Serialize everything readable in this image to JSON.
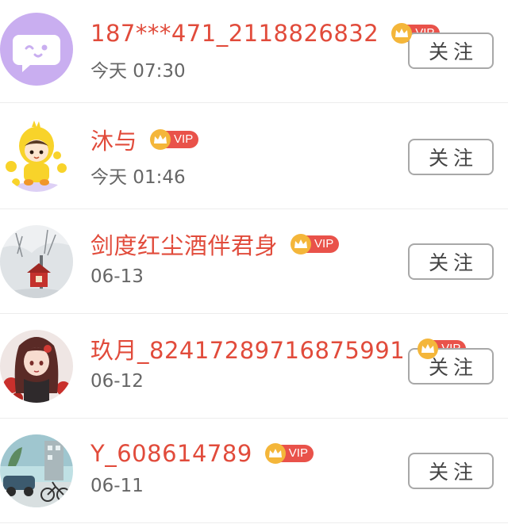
{
  "follow_list": [
    {
      "name": "187***471_2118826832",
      "vip_label": "VIP",
      "time": "今天 07:30",
      "button": "关注",
      "avatar": "chat-bubble-icon"
    },
    {
      "name": "沐与",
      "vip_label": "VIP",
      "time": "今天 01:46",
      "button": "关注",
      "avatar": "cartoon-chick-avatar"
    },
    {
      "name": "剑度红尘酒伴君身",
      "vip_label": "VIP",
      "time": "06-13",
      "button": "关注",
      "avatar": "winter-scene-avatar"
    },
    {
      "name": "玖月_82417289716875991",
      "vip_label": "VIP",
      "time": "06-12",
      "button": "关注",
      "avatar": "anime-girl-avatar"
    },
    {
      "name": "Y_608614789",
      "vip_label": "VIP",
      "time": "06-11",
      "button": "关注",
      "avatar": "street-scene-avatar"
    }
  ],
  "colors": {
    "name": "#e14b3b",
    "vip_tag": "#e9524a",
    "crown": "#f4b63a",
    "default_avatar_bg": "#c9aef0"
  }
}
